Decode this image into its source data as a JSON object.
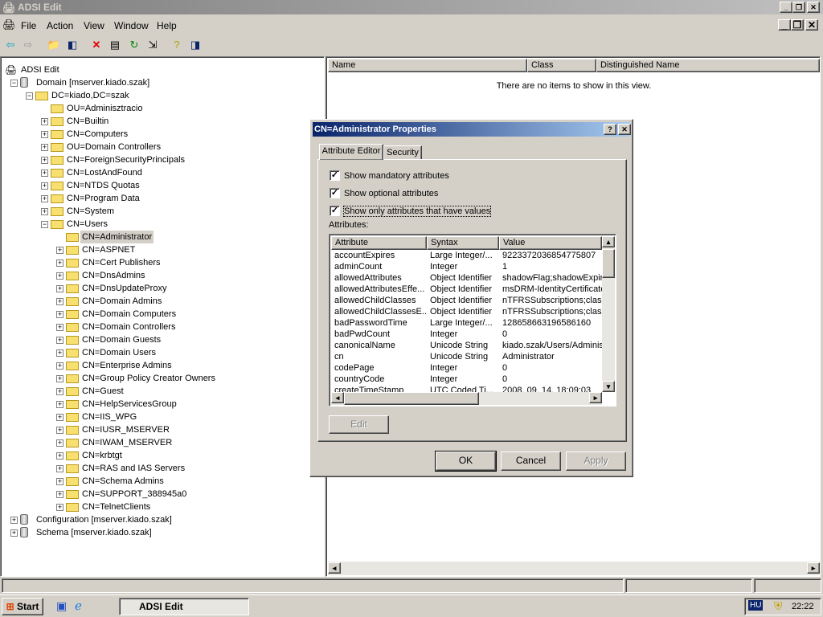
{
  "window": {
    "title": "ADSI Edit",
    "icon": "adsi-edit-icon"
  },
  "menu": [
    "File",
    "Action",
    "View",
    "Window",
    "Help"
  ],
  "toolbar": [
    "back-icon",
    "forward-icon",
    "up-folder-icon",
    "show-hide-tree-icon",
    "delete-icon",
    "properties-icon",
    "refresh-icon",
    "export-list-icon",
    "help-icon",
    "show-action-pane-icon"
  ],
  "tree": [
    {
      "label": "ADSI Edit",
      "level": 0,
      "icon": "adsi",
      "exp": ""
    },
    {
      "label": "Domain [mserver.kiado.szak]",
      "level": 1,
      "icon": "db",
      "exp": "-"
    },
    {
      "label": "DC=kiado,DC=szak",
      "level": 2,
      "icon": "folder",
      "exp": "-"
    },
    {
      "label": "OU=Adminisztracio",
      "level": 3,
      "icon": "folder",
      "exp": ""
    },
    {
      "label": "CN=Builtin",
      "level": 3,
      "icon": "folder",
      "exp": "+"
    },
    {
      "label": "CN=Computers",
      "level": 3,
      "icon": "folder",
      "exp": "+"
    },
    {
      "label": "OU=Domain Controllers",
      "level": 3,
      "icon": "folder",
      "exp": "+"
    },
    {
      "label": "CN=ForeignSecurityPrincipals",
      "level": 3,
      "icon": "folder",
      "exp": "+"
    },
    {
      "label": "CN=LostAndFound",
      "level": 3,
      "icon": "folder",
      "exp": "+"
    },
    {
      "label": "CN=NTDS Quotas",
      "level": 3,
      "icon": "folder",
      "exp": "+"
    },
    {
      "label": "CN=Program Data",
      "level": 3,
      "icon": "folder",
      "exp": "+"
    },
    {
      "label": "CN=System",
      "level": 3,
      "icon": "folder",
      "exp": "+"
    },
    {
      "label": "CN=Users",
      "level": 3,
      "icon": "folder",
      "exp": "-"
    },
    {
      "label": "CN=Administrator",
      "level": 4,
      "icon": "folder",
      "exp": "",
      "selected": true
    },
    {
      "label": "CN=ASPNET",
      "level": 4,
      "icon": "folder",
      "exp": "+"
    },
    {
      "label": "CN=Cert Publishers",
      "level": 4,
      "icon": "folder",
      "exp": "+"
    },
    {
      "label": "CN=DnsAdmins",
      "level": 4,
      "icon": "folder",
      "exp": "+"
    },
    {
      "label": "CN=DnsUpdateProxy",
      "level": 4,
      "icon": "folder",
      "exp": "+"
    },
    {
      "label": "CN=Domain Admins",
      "level": 4,
      "icon": "folder",
      "exp": "+"
    },
    {
      "label": "CN=Domain Computers",
      "level": 4,
      "icon": "folder",
      "exp": "+"
    },
    {
      "label": "CN=Domain Controllers",
      "level": 4,
      "icon": "folder",
      "exp": "+"
    },
    {
      "label": "CN=Domain Guests",
      "level": 4,
      "icon": "folder",
      "exp": "+"
    },
    {
      "label": "CN=Domain Users",
      "level": 4,
      "icon": "folder",
      "exp": "+"
    },
    {
      "label": "CN=Enterprise Admins",
      "level": 4,
      "icon": "folder",
      "exp": "+"
    },
    {
      "label": "CN=Group Policy Creator Owners",
      "level": 4,
      "icon": "folder",
      "exp": "+"
    },
    {
      "label": "CN=Guest",
      "level": 4,
      "icon": "folder",
      "exp": "+"
    },
    {
      "label": "CN=HelpServicesGroup",
      "level": 4,
      "icon": "folder",
      "exp": "+"
    },
    {
      "label": "CN=IIS_WPG",
      "level": 4,
      "icon": "folder",
      "exp": "+"
    },
    {
      "label": "CN=IUSR_MSERVER",
      "level": 4,
      "icon": "folder",
      "exp": "+"
    },
    {
      "label": "CN=IWAM_MSERVER",
      "level": 4,
      "icon": "folder",
      "exp": "+"
    },
    {
      "label": "CN=krbtgt",
      "level": 4,
      "icon": "folder",
      "exp": "+"
    },
    {
      "label": "CN=RAS and IAS Servers",
      "level": 4,
      "icon": "folder",
      "exp": "+"
    },
    {
      "label": "CN=Schema Admins",
      "level": 4,
      "icon": "folder",
      "exp": "+"
    },
    {
      "label": "CN=SUPPORT_388945a0",
      "level": 4,
      "icon": "folder",
      "exp": "+"
    },
    {
      "label": "CN=TelnetClients",
      "level": 4,
      "icon": "folder",
      "exp": "+"
    },
    {
      "label": "Configuration [mserver.kiado.szak]",
      "level": 1,
      "icon": "db",
      "exp": "+"
    },
    {
      "label": "Schema [mserver.kiado.szak]",
      "level": 1,
      "icon": "db",
      "exp": "+"
    }
  ],
  "list": {
    "columns": [
      "Name",
      "Class",
      "Distinguished Name"
    ],
    "empty": "There are no items to show in this view."
  },
  "dialog": {
    "title": "CN=Administrator Properties",
    "tabs": [
      "Attribute Editor",
      "Security"
    ],
    "checks": [
      {
        "label": "Show mandatory attributes",
        "checked": true
      },
      {
        "label": "Show optional attributes",
        "checked": true
      },
      {
        "label": "Show only attributes that have values",
        "checked": true
      }
    ],
    "attributes_label": "Attributes:",
    "columns": [
      "Attribute",
      "Syntax",
      "Value"
    ],
    "rows": [
      [
        "accountExpires",
        "Large Integer/...",
        "9223372036854775807"
      ],
      [
        "adminCount",
        "Integer",
        "1"
      ],
      [
        "allowedAttributes",
        "Object Identifier",
        "shadowFlag;shadowExpire"
      ],
      [
        "allowedAttributesEffe...",
        "Object Identifier",
        "msDRM-IdentityCertificate"
      ],
      [
        "allowedChildClasses",
        "Object Identifier",
        "nTFRSSubscriptions;class"
      ],
      [
        "allowedChildClassesE...",
        "Object Identifier",
        "nTFRSSubscriptions;class"
      ],
      [
        "badPasswordTime",
        "Large Integer/...",
        "128658663196586160"
      ],
      [
        "badPwdCount",
        "Integer",
        "0"
      ],
      [
        "canonicalName",
        "Unicode String",
        "kiado.szak/Users/Administrator"
      ],
      [
        "cn",
        "Unicode String",
        "Administrator"
      ],
      [
        "codePage",
        "Integer",
        "0"
      ],
      [
        "countryCode",
        "Integer",
        "0"
      ],
      [
        "createTimeStamp",
        "UTC Coded Ti...",
        "2008. 09. 14. 18:09:03"
      ]
    ],
    "edit": "Edit",
    "ok": "OK",
    "cancel": "Cancel",
    "apply": "Apply"
  },
  "taskbar": {
    "start": "Start",
    "task": "ADSI Edit",
    "lang": "HU",
    "clock": "22:22"
  }
}
